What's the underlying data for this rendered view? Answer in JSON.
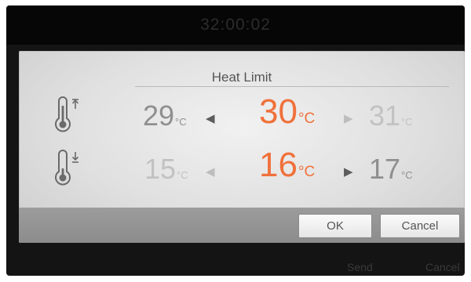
{
  "background": {
    "timer": "32:00:02",
    "send_label": "Send",
    "cancel_label": "Cancel"
  },
  "dialog": {
    "title": "Heat Limit",
    "unit": "°C",
    "max_row": {
      "icon": "thermometer-max-icon",
      "prev_value": "29",
      "current_value": "30",
      "next_value": "31"
    },
    "min_row": {
      "icon": "thermometer-min-icon",
      "prev_value": "15",
      "current_value": "16",
      "next_value": "17"
    },
    "ok_label": "OK",
    "cancel_label": "Cancel"
  },
  "colors": {
    "accent": "#f0713b",
    "dialog_bg": "#e4e4e4",
    "footer_bg": "#949494"
  }
}
